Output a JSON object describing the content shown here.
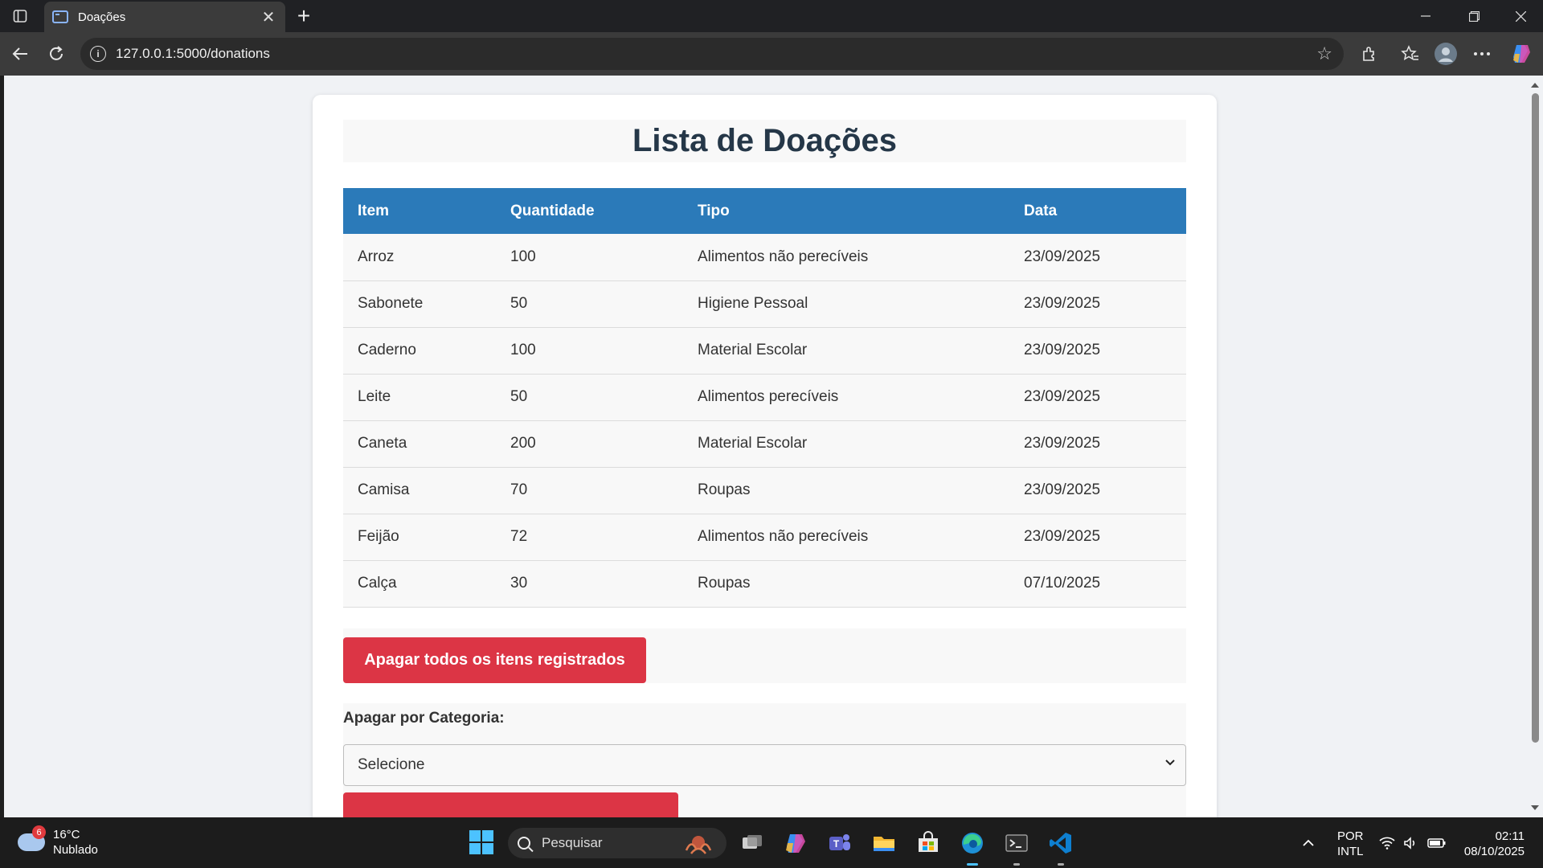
{
  "browser": {
    "tab_title": "Doações",
    "tab_close": "✕",
    "new_tab": "+",
    "url": "127.0.0.1:5000/donations",
    "info_glyph": "i",
    "star_glyph": "☆"
  },
  "page": {
    "title": "Lista de Doações",
    "table": {
      "headers": [
        "Item",
        "Quantidade",
        "Tipo",
        "Data"
      ],
      "rows": [
        [
          "Arroz",
          "100",
          "Alimentos não perecíveis",
          "23/09/2025"
        ],
        [
          "Sabonete",
          "50",
          "Higiene Pessoal",
          "23/09/2025"
        ],
        [
          "Caderno",
          "100",
          "Material Escolar",
          "23/09/2025"
        ],
        [
          "Leite",
          "50",
          "Alimentos perecíveis",
          "23/09/2025"
        ],
        [
          "Caneta",
          "200",
          "Material Escolar",
          "23/09/2025"
        ],
        [
          "Camisa",
          "70",
          "Roupas",
          "23/09/2025"
        ],
        [
          "Feijão",
          "72",
          "Alimentos não perecíveis",
          "23/09/2025"
        ],
        [
          "Calça",
          "30",
          "Roupas",
          "07/10/2025"
        ]
      ]
    },
    "delete_all_label": "Apagar todos os itens registrados",
    "category_label": "Apagar por Categoria:",
    "category_select_value": "Selecione",
    "select_chevron": "⌄"
  },
  "taskbar": {
    "weather_badge": "6",
    "weather_temp": "16°C",
    "weather_desc": "Nublado",
    "search_placeholder": "Pesquisar",
    "lang_top": "POR",
    "lang_bottom": "INTL",
    "time": "02:11",
    "date": "08/10/2025",
    "tray_chevron": "^"
  },
  "colors": {
    "table_header": "#2b7ab9",
    "danger": "#dc3545",
    "heading": "#253748"
  },
  "icons": [
    "sidebar-toggle-icon",
    "tab-favicon-icon",
    "back-icon",
    "reload-icon",
    "info-icon",
    "favorite-star-icon",
    "extensions-icon",
    "favorites-icon",
    "profile-avatar-icon",
    "more-icon",
    "copilot-icon",
    "chevron-down-icon",
    "weather-cloud-icon",
    "windows-start-icon",
    "search-icon",
    "task-view-icon",
    "copilot-app-icon",
    "teams-icon",
    "file-explorer-icon",
    "store-icon",
    "edge-icon",
    "terminal-icon",
    "vscode-icon",
    "wifi-icon",
    "volume-icon",
    "battery-icon"
  ]
}
